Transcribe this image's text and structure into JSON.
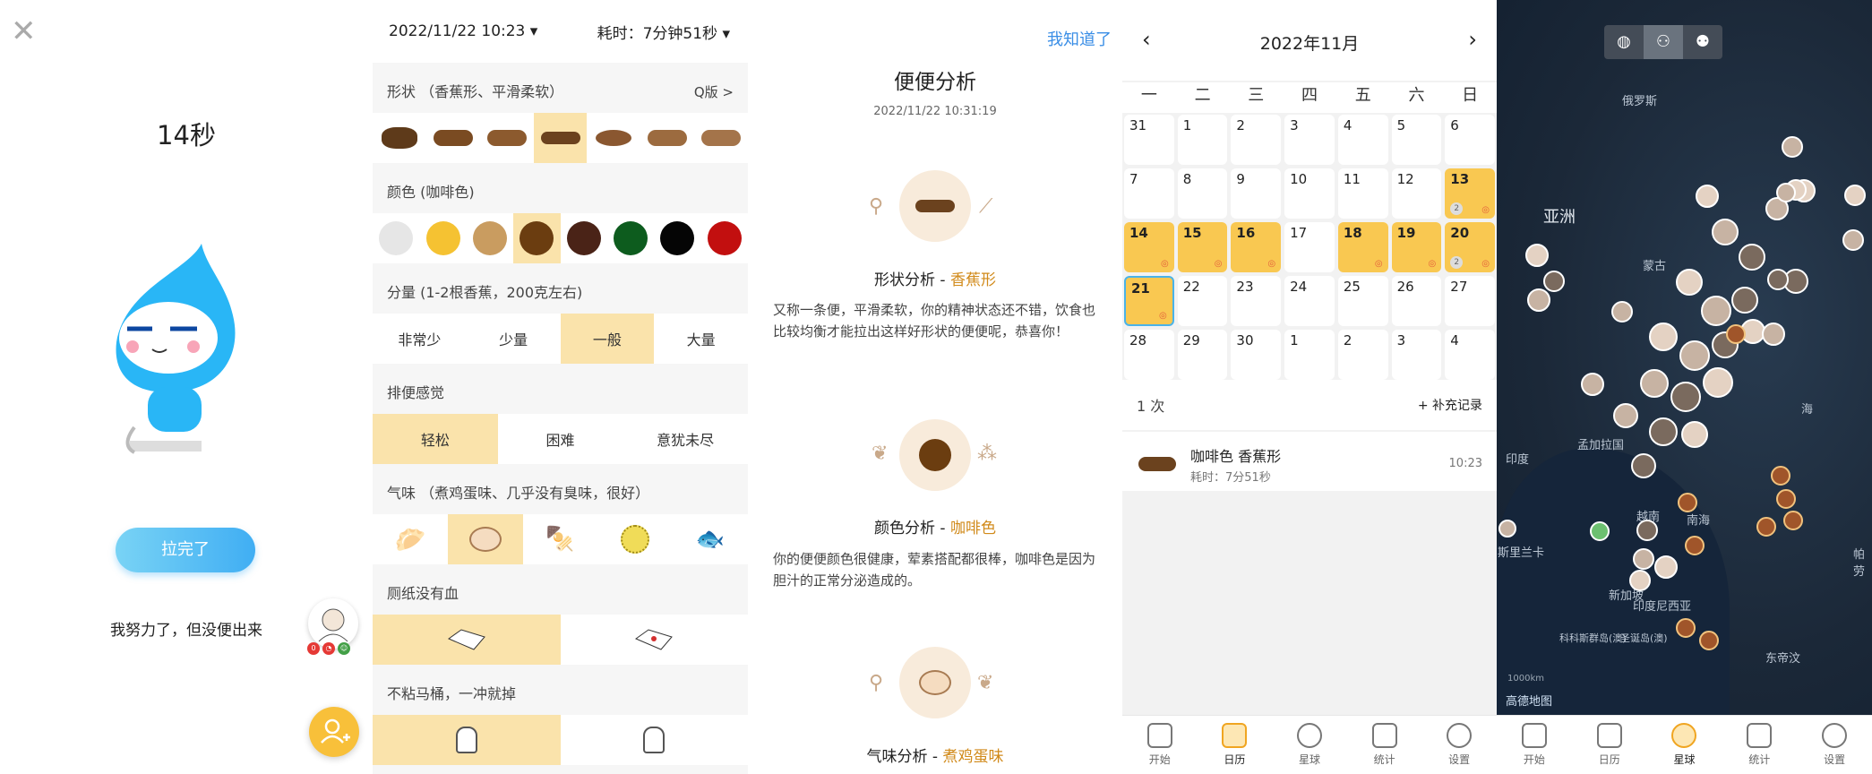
{
  "timer_screen": {
    "elapsed": "14秒",
    "done_button": "拉完了",
    "tried_text": "我努力了，但没便出来"
  },
  "record_screen": {
    "datetime": "2022/11/22 10:23 ▾",
    "duration": "耗时：7分钟51秒 ▾",
    "shape_label": "形状 （香蕉形、平滑柔软）",
    "shape_link": "Q版 >",
    "color_label": "颜色 (咖啡色)",
    "colors": [
      "#e6e6e6",
      "#f5c232",
      "#c99c60",
      "#6b3d10",
      "#4a2317",
      "#0d5c1e",
      "#050505",
      "#c20f0f"
    ],
    "amount_label": "分量 (1-2根香蕉，200克左右)",
    "amount_options": [
      "非常少",
      "少量",
      "一般",
      "大量"
    ],
    "feel_label": "排便感觉",
    "feel_options": [
      "轻松",
      "困难",
      "意犹未尽"
    ],
    "smell_label": "气味 （煮鸡蛋味、几乎没有臭味，很好）",
    "paper_label": "厕纸没有血",
    "toilet_label": "不粘马桶，一冲就掉"
  },
  "analysis_screen": {
    "got_it": "我知道了",
    "title": "便便分析",
    "datetime": "2022/11/22 10:31:19",
    "shape_title": "形状分析 - ",
    "shape_value": "香蕉形",
    "shape_desc": "又称一条便，平滑柔软，你的精神状态还不错，饮食也比较均衡才能拉出这样好形状的便便呢，恭喜你！",
    "color_title": "颜色分析 - ",
    "color_value": "咖啡色",
    "color_desc": "你的便便颜色很健康，荤素搭配都很棒，咖啡色是因为胆汁的正常分泌造成的。",
    "smell_title": "气味分析 - ",
    "smell_value": "煮鸡蛋味"
  },
  "calendar_screen": {
    "month": "2022年11月",
    "weekdays": [
      "一",
      "二",
      "三",
      "四",
      "五",
      "六",
      "日"
    ],
    "days": [
      "31",
      "1",
      "2",
      "3",
      "4",
      "5",
      "6",
      "7",
      "8",
      "9",
      "10",
      "11",
      "12",
      "13",
      "14",
      "15",
      "16",
      "17",
      "18",
      "19",
      "20",
      "21",
      "22",
      "23",
      "24",
      "25",
      "26",
      "27",
      "28",
      "29",
      "30",
      "1",
      "2",
      "3",
      "4"
    ],
    "count_text": "1 次",
    "add_record": "+ 补充记录",
    "entry_title": "咖啡色 香蕉形",
    "entry_duration": "耗时：7分51秒",
    "entry_time": "10:23",
    "badge_two": "2"
  },
  "tabs": [
    "开始",
    "日历",
    "星球",
    "统计",
    "设置"
  ],
  "map_screen": {
    "labels": {
      "russia": "俄罗斯",
      "asia": "亚洲",
      "mongolia": "蒙古",
      "india": "印度",
      "bangladesh": "孟加拉国",
      "vietnam": "越南",
      "south_sea": "南海",
      "srilanka": "斯里兰卡",
      "indonesia": "印度尼西亚",
      "east_timor": "东帝汶",
      "singapore": "新加坡",
      "cocos": "科科斯群岛(澳)",
      "christmas": "圣诞岛(澳)",
      "palau": "帕劳",
      "hai": "海"
    },
    "scale": "1000km",
    "logo": "高德地图"
  }
}
